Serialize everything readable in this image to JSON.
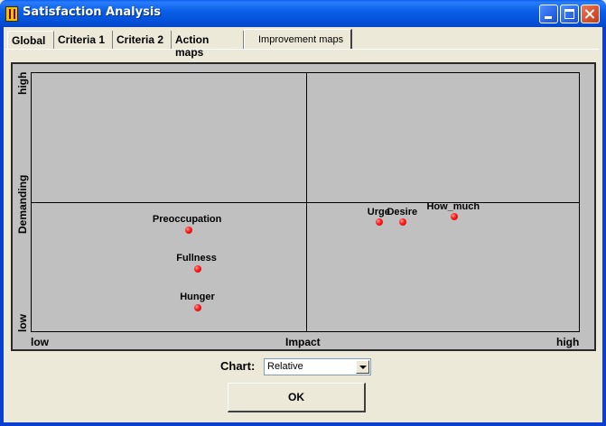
{
  "window": {
    "title": "Satisfaction Analysis",
    "accent": "#0a5fe8"
  },
  "tabs": [
    {
      "label": "Global",
      "active": false
    },
    {
      "label": "Criteria 1",
      "active": false
    },
    {
      "label": "Criteria 2",
      "active": false
    },
    {
      "label": "Action maps",
      "active": false
    },
    {
      "label": "Improvement maps",
      "active": true
    }
  ],
  "map": {
    "y_axis": {
      "title": "Demanding",
      "low": "low",
      "high": "high"
    },
    "x_axis": {
      "title": "Impact",
      "low": "low",
      "high": "high"
    },
    "point_color": "#ff2020",
    "points": [
      {
        "label": "Preoccupation",
        "impact": 0.287,
        "demanding": 0.393
      },
      {
        "label": "Fullness",
        "impact": 0.304,
        "demanding": 0.24
      },
      {
        "label": "Hunger",
        "impact": 0.304,
        "demanding": 0.09
      },
      {
        "label": "Urge",
        "impact": 0.635,
        "demanding": 0.424
      },
      {
        "label": "Desire",
        "impact": 0.679,
        "demanding": 0.424
      },
      {
        "label": "How_much",
        "impact": 0.773,
        "demanding": 0.444
      }
    ]
  },
  "controls": {
    "chart_label": "Chart:",
    "chart_selected": "Relative",
    "ok_label": "OK"
  }
}
